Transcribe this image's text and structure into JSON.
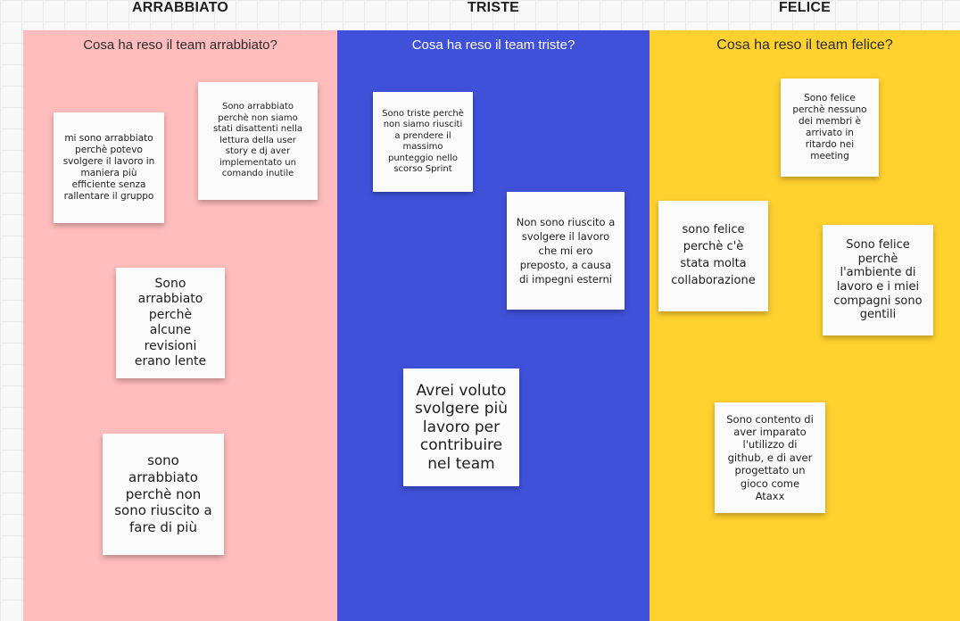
{
  "headers": {
    "angry": "ARRABBIATO",
    "sad": "TRISTE",
    "happy": "FELICE"
  },
  "columns": {
    "angry": {
      "title": "Cosa ha reso il team arrabbiato?",
      "color": "#ffbcbc"
    },
    "sad": {
      "title": "Cosa ha reso il team triste?",
      "color": "#3f51d9"
    },
    "happy": {
      "title": "Cosa ha reso il team felice?",
      "color": "#ffd12e"
    }
  },
  "notes": {
    "angry": [
      "mi sono arrabbiato perchè potevo svolgere il lavoro in maniera più efficiente senza rallentare il gruppo",
      "Sono arrabbiato perchè non siamo stati disattenti nella lettura della user story e dj aver implementato un comando inutile",
      "Sono arrabbiato perchè alcune revisioni erano lente",
      "sono arrabbiato perchè non sono riuscito a fare di più"
    ],
    "sad": [
      "Sono triste perchè non siamo riusciti a prendere il massimo punteggio nello scorso Sprint",
      "Non sono riuscito a svolgere il lavoro che mi ero preposto, a causa di impegni esterni",
      "Avrei voluto svolgere più lavoro per contribuire nel team"
    ],
    "happy": [
      "Sono felice perchè nessuno dei membri è arrivato in ritardo nei meeting",
      "sono felice perchè c'è stata molta collaborazione",
      "Sono felice perchè l'ambiente di lavoro e i miei compagni sono gentili",
      "Sono contento di aver imparato l'utilizzo di github, e di aver progettato un gioco come Ataxx"
    ]
  }
}
